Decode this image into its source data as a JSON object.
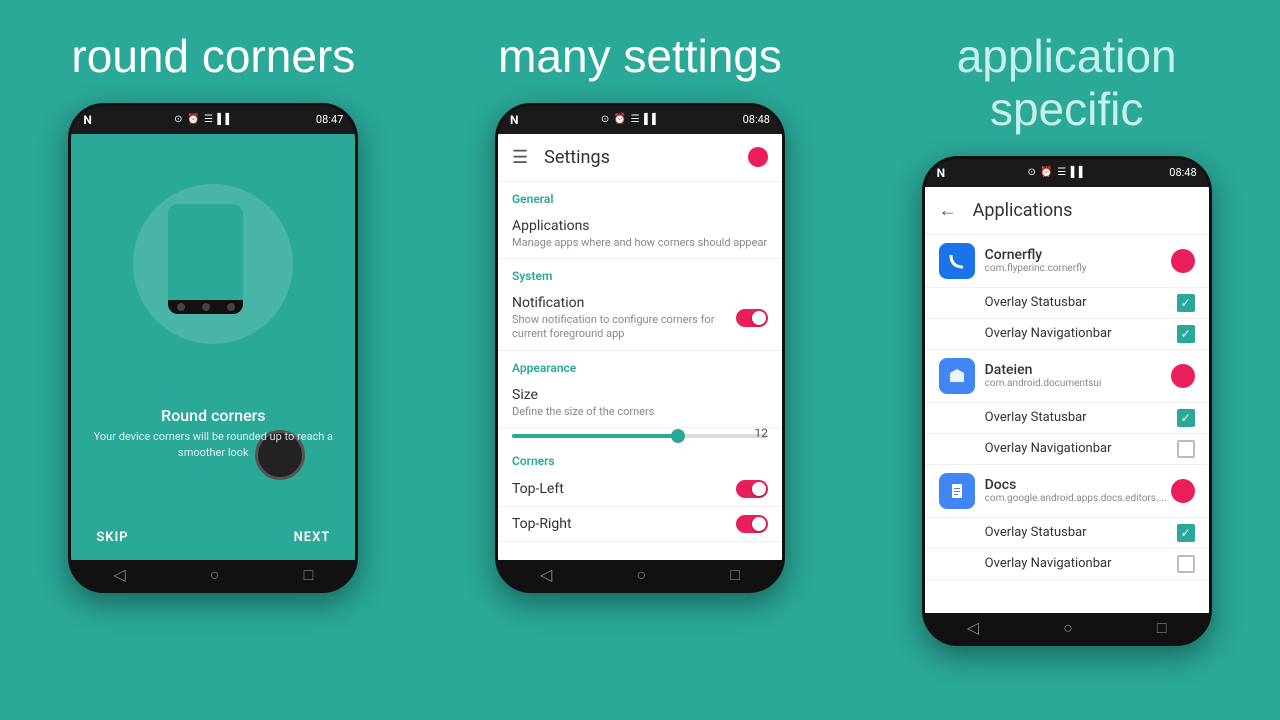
{
  "columns": [
    {
      "title": "round corners",
      "title_class": "normal",
      "phone": {
        "status_logo": "N",
        "status_icons": "⊙ ⏰ ☰ ▌▌",
        "status_time": "08:47",
        "content_title": "Round corners",
        "content_subtitle": "Your device corners will be rounded up to reach a smoother look",
        "skip_btn": "SKIP",
        "next_btn": "NEXT"
      }
    },
    {
      "title": "many settings",
      "title_class": "normal",
      "phone": {
        "status_logo": "N",
        "status_icons": "⊙ ⏰ ☰ ▌▌",
        "status_time": "08:48",
        "toolbar_title": "Settings",
        "sections": [
          {
            "header": "General",
            "items": [
              {
                "title": "Applications",
                "subtitle": "Manage apps where and how corners should appear",
                "control": "none"
              }
            ]
          },
          {
            "header": "System",
            "items": [
              {
                "title": "Notification",
                "subtitle": "Show notification to configure corners for current foreground app",
                "control": "toggle_on"
              }
            ]
          },
          {
            "header": "Appearance",
            "items": [
              {
                "title": "Size",
                "subtitle": "Define the size of the corners",
                "control": "slider",
                "slider_value": "12"
              }
            ]
          },
          {
            "header": "Corners",
            "items": [
              {
                "title": "Top-Left",
                "subtitle": "",
                "control": "toggle_on"
              },
              {
                "title": "Top-Right",
                "subtitle": "",
                "control": "toggle_on"
              }
            ]
          }
        ]
      }
    },
    {
      "title": "application\nspecific",
      "title_class": "light",
      "phone": {
        "status_logo": "N",
        "status_icons": "⊙ ⏰ ☰ ▌▌",
        "status_time": "08:48",
        "toolbar_title": "Applications",
        "apps": [
          {
            "name": "Cornerfly",
            "package": "com.flyperinc.cornerfly",
            "icon_color": "#1a73e8",
            "icon_char": "◆",
            "toggle": "red",
            "sub_items": [
              {
                "label": "Overlay Statusbar",
                "checked": true
              },
              {
                "label": "Overlay Navigationbar",
                "checked": true
              }
            ]
          },
          {
            "name": "Dateien",
            "package": "com.android.documentsui",
            "icon_color": "#4285f4",
            "icon_char": "📁",
            "toggle": "red",
            "sub_items": [
              {
                "label": "Overlay Statusbar",
                "checked": true
              },
              {
                "label": "Overlay Navigationbar",
                "checked": false
              }
            ]
          },
          {
            "name": "Docs",
            "package": "com.google.android.apps.docs.editors....",
            "icon_color": "#4285f4",
            "icon_char": "📄",
            "toggle": "red",
            "sub_items": [
              {
                "label": "Overlay Statusbar",
                "checked": true
              },
              {
                "label": "Overlay Navigationbar",
                "checked": false
              }
            ]
          }
        ]
      }
    }
  ]
}
